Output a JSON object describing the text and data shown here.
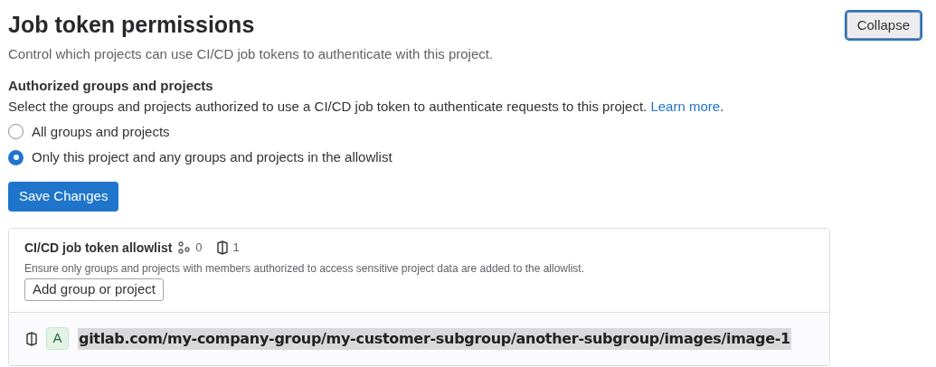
{
  "title": "Job token permissions",
  "description": "Control which projects can use CI/CD job tokens to authenticate with this project.",
  "collapse_button": "Collapse",
  "authorized": {
    "heading": "Authorized groups and projects",
    "text": "Select the groups and projects authorized to use a CI/CD job token to authenticate requests to this project.",
    "link": "Learn more",
    "link_suffix": ".",
    "options": [
      {
        "label": "All groups and projects",
        "selected": false
      },
      {
        "label": "Only this project and any groups and projects in the allowlist",
        "selected": true
      }
    ]
  },
  "save_button": "Save Changes",
  "allowlist": {
    "title": "CI/CD job token allowlist",
    "group_count": "0",
    "project_count": "1",
    "description": "Ensure only groups and projects with members authorized to access sensitive project data are added to the allowlist.",
    "add_button": "Add group or project",
    "rows": [
      {
        "avatar": "A",
        "path": "gitlab.com/my-company-group/my-customer-subgroup/another-subgroup/images/image-1"
      }
    ]
  }
}
